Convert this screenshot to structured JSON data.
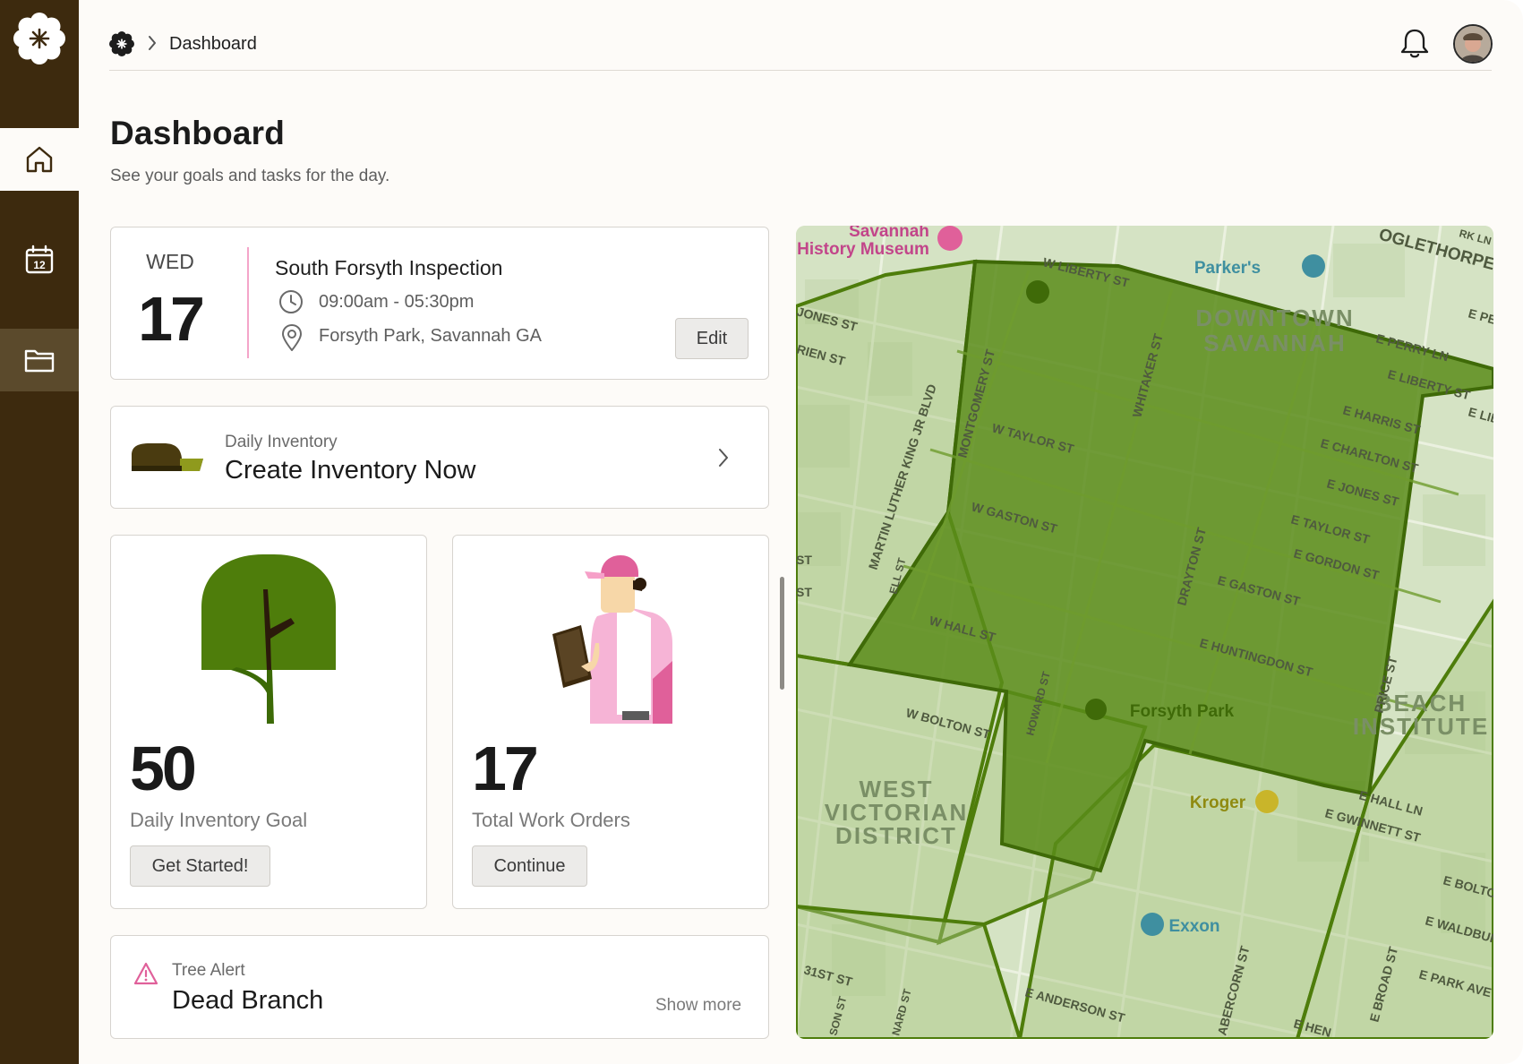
{
  "app": {
    "breadcrumb": {
      "current": "Dashboard"
    },
    "colors": {
      "sidebar": "#3d2a0e",
      "accent_pink": "#f4a5c9",
      "tree_green": "#4e7d0b",
      "map_zone": "#5a8c1a"
    }
  },
  "sidebar": {
    "items": [
      {
        "icon": "home-icon",
        "active": true
      },
      {
        "icon": "calendar-icon",
        "badge": "12"
      },
      {
        "icon": "folder-icon"
      }
    ]
  },
  "header": {
    "title": "Dashboard",
    "subtitle": "See your goals and tasks for the day."
  },
  "event": {
    "day": "WED",
    "date": "17",
    "title": "South Forsyth Inspection",
    "time": "09:00am - 05:30pm",
    "location": "Forsyth Park, Savannah GA",
    "edit_label": "Edit"
  },
  "inventory": {
    "label": "Daily Inventory",
    "title": "Create Inventory Now"
  },
  "stats": [
    {
      "value": "50",
      "label": "Daily Inventory Goal",
      "button": "Get Started!"
    },
    {
      "value": "17",
      "label": "Total Work Orders",
      "button": "Continue"
    }
  ],
  "alert": {
    "label": "Tree Alert",
    "title": "Dead Branch",
    "more": "Show more"
  },
  "map": {
    "districts": [
      "DOWNTOWN",
      "SAVANNAH",
      "WEST",
      "VICTORIAN",
      "DISTRICT",
      "BEACH",
      "INSTITUTE"
    ],
    "pois": [
      "Savannah",
      "History Museum",
      "Parker's",
      "Forsyth Park",
      "Kroger",
      "Exxon"
    ],
    "streets": [
      "W LIBERTY ST",
      "OGLETHORPE A",
      "E PERRY LN",
      "E LIBERTY ST",
      "E HARRIS ST",
      "E CHARLTON ST",
      "E JONES ST",
      "E TAYLOR ST",
      "E GORDON ST",
      "E GASTON ST",
      "E HUNTINGDON ST",
      "W TAYLOR ST",
      "W GASTON ST",
      "W HALL ST",
      "W BOLTON ST",
      "MONTGOMERY ST",
      "WHITAKER ST",
      "DRAYTON ST",
      "MARTIN LUTHER KING JR BLVD",
      "E HALL LN",
      "E GWINNETT ST",
      "E BOLTO",
      "E WALDBUR",
      "E PARK AVE",
      "E ANDERSON ST",
      "31ST ST",
      "E HEN",
      "JONES ST",
      "RIEN ST",
      "E PE",
      "E LIB",
      "PRICE ST",
      "ABERCORN ST",
      "E BROAD ST",
      "HOWARD ST",
      "ELL ST",
      "RK LN",
      "NARD ST",
      "SON ST",
      "ST"
    ]
  }
}
